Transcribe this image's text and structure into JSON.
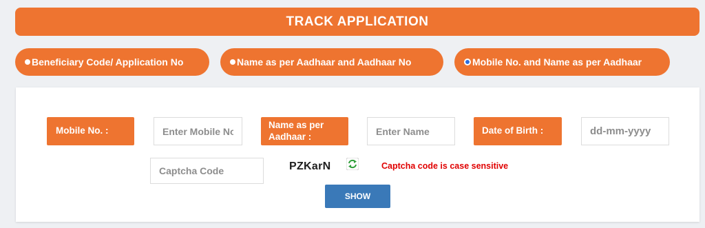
{
  "header": {
    "title": "TRACK APPLICATION"
  },
  "search_options": [
    {
      "label": "Beneficiary Code/ Application No",
      "selected": false
    },
    {
      "label": "Name as per Aadhaar and Aadhaar No",
      "selected": false
    },
    {
      "label": "Mobile No. and Name as per Aadhaar",
      "selected": true
    }
  ],
  "form": {
    "mobile_label": "Mobile No. :",
    "mobile_placeholder": "Enter Mobile No",
    "name_label": "Name as per Aadhaar :",
    "name_placeholder": "Enter Name",
    "dob_label": "Date of Birth :",
    "dob_placeholder": "dd-mm-yyyy",
    "captcha_placeholder": "Captcha Code",
    "captcha_value": "PZKarN",
    "captcha_note": "Captcha code is case sensitive",
    "show_label": "SHOW"
  },
  "colors": {
    "accent": "#ee7430",
    "button": "#3a79b8",
    "error": "#e00000",
    "radio_checked": "#2c6ddf"
  },
  "icons": {
    "refresh": "refresh-icon"
  }
}
